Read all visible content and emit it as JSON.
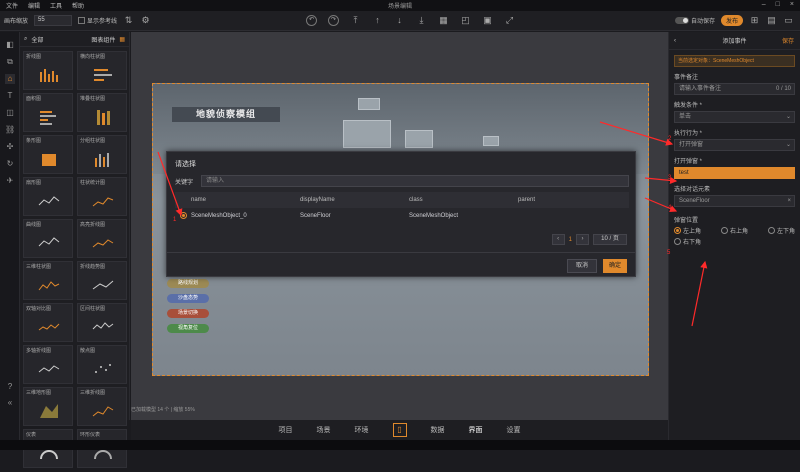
{
  "menubar": {
    "items": [
      "文件",
      "编辑",
      "工具",
      "帮助"
    ],
    "title": "场景编辑"
  },
  "toolbar": {
    "label": "画布缩放",
    "zoom_value": "55",
    "check_label": "显示参考线",
    "toggle_label": "自动保存",
    "pill_label": "发布"
  },
  "library": {
    "tabs": [
      "全部",
      "图表组件"
    ],
    "cards": [
      "折线图",
      "横向柱状图",
      "面积图",
      "堆叠柱状图",
      "条形图",
      "分组柱状图",
      "扇形图",
      "柱状统计图",
      "曲线图",
      "高亮折线图",
      "三维柱状图",
      "折线趋势图",
      "双轴对比图",
      "区间柱状图",
      "多轴折线图",
      "散点图",
      "三维地形图",
      "三维折线图",
      "仪表",
      "环形仪表"
    ]
  },
  "scene": {
    "banner": "地貌侦察模组",
    "buttons": [
      "路线规划",
      "沙盘态势",
      "场景切换",
      "视角复位"
    ],
    "button_colors": [
      "#9c8a55",
      "#5a6fa8",
      "#a84f3a",
      "#4d8a4a"
    ]
  },
  "status_line": "已加载模型 14 个 | 缩放 55%",
  "dialog": {
    "title": "请选择",
    "keyword_label": "关键字",
    "search_placeholder": "请输入",
    "columns": [
      "name",
      "displayName",
      "class",
      "parent"
    ],
    "rows": [
      {
        "name": "SceneMeshObject_0",
        "displayName": "SceneFloor",
        "class": "SceneMeshObject",
        "parent": ""
      }
    ],
    "pager": {
      "current": "1",
      "page_size": "10 / 页"
    },
    "cancel_label": "取消",
    "ok_label": "确定"
  },
  "rightpanel": {
    "title": "添加事件",
    "back": "‹",
    "done": "保存",
    "target": "当前选定对象：SceneMeshObject",
    "fields": {
      "event_note_label": "事件备注",
      "event_note_placeholder": "请输入事件备注",
      "event_note_count": "0 / 10",
      "trigger_label": "触发条件 *",
      "trigger_value": "单击",
      "action_label": "执行行为 *",
      "action_value": "打开弹窗",
      "popup_label": "打开弹窗 *",
      "popup_value": "test",
      "element_label": "选择对话元素",
      "element_value": "SceneFloor",
      "position_label": "弹窗位置"
    },
    "positions": [
      "左上角",
      "右上角",
      "左下角",
      "右下角"
    ]
  },
  "bottomnav": {
    "items": [
      "项目",
      "场景",
      "环境",
      "数据",
      "界面",
      "设置"
    ],
    "active": "界面"
  },
  "annotations": {
    "numbers": [
      "1",
      "2",
      "3",
      "4",
      "5"
    ],
    "color": "#ff2a2a"
  },
  "colors": {
    "accent": "#e0892c",
    "panel": "#1e1e22"
  }
}
